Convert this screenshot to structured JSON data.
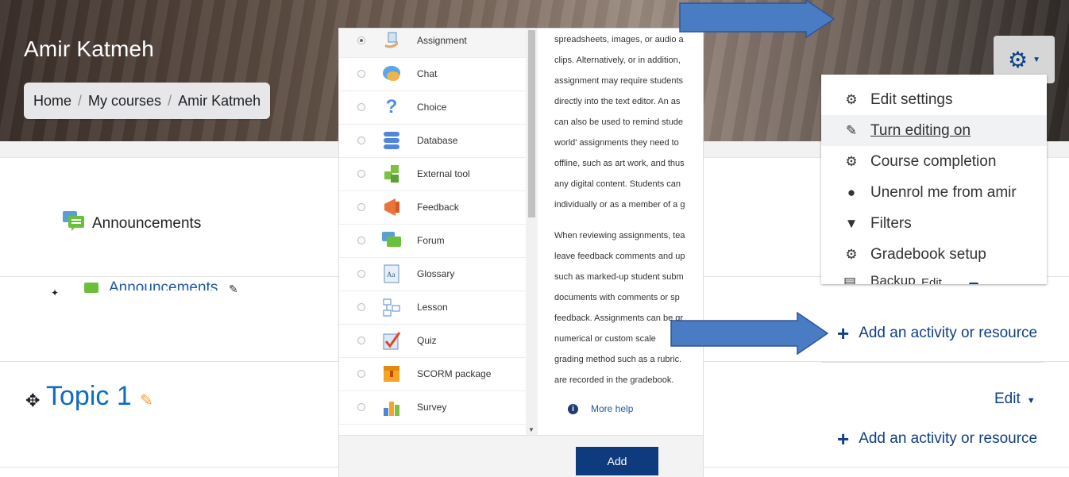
{
  "header": {
    "course_title": "Amir Katmeh",
    "breadcrumb": [
      "Home",
      "My courses",
      "Amir Katmeh"
    ],
    "breadcrumb_separator": "/"
  },
  "section0": {
    "title": "Announcements",
    "activity_link": "Announcements"
  },
  "topic1": {
    "title": "Topic 1",
    "edit_menu": "Edit"
  },
  "add_activity_label": "Add an activity or resource",
  "chooser": {
    "items": [
      {
        "label": "Assignment",
        "icon": "assignment-icon",
        "selected": true
      },
      {
        "label": "Chat",
        "icon": "chat-icon",
        "selected": false
      },
      {
        "label": "Choice",
        "icon": "choice-icon",
        "selected": false
      },
      {
        "label": "Database",
        "icon": "database-icon",
        "selected": false
      },
      {
        "label": "External tool",
        "icon": "external-tool-icon",
        "selected": false
      },
      {
        "label": "Feedback",
        "icon": "feedback-icon",
        "selected": false
      },
      {
        "label": "Forum",
        "icon": "forum-icon",
        "selected": false
      },
      {
        "label": "Glossary",
        "icon": "glossary-icon",
        "selected": false
      },
      {
        "label": "Lesson",
        "icon": "lesson-icon",
        "selected": false
      },
      {
        "label": "Quiz",
        "icon": "quiz-icon",
        "selected": false
      },
      {
        "label": "SCORM package",
        "icon": "scorm-icon",
        "selected": false
      },
      {
        "label": "Survey",
        "icon": "survey-icon",
        "selected": false
      }
    ],
    "description_lines": [
      "spreadsheets, images, or audio a",
      "clips. Alternatively, or in addition,",
      "assignment may require students",
      "directly into the text editor. An as",
      "can also be used to remind stude",
      "world' assignments they need to",
      "offline, such as art work, and thus",
      "any digital content. Students can",
      "individually or as a member of a g"
    ],
    "description_lines_2": [
      "When reviewing assignments, tea",
      "leave feedback comments and up",
      "such as marked-up student subm",
      "documents with comments or sp",
      "feedback. Assignments can be gr",
      "numerical or custom scale",
      "grading method such as a rubric.",
      "are recorded in the gradebook."
    ],
    "more_help": "More help",
    "add_button": "Add"
  },
  "settings_menu": {
    "items": [
      {
        "label": "Edit settings",
        "icon": "gear-icon"
      },
      {
        "label": "Turn editing on",
        "icon": "pencil-icon"
      },
      {
        "label": "Course completion",
        "icon": "gear-icon"
      },
      {
        "label": "Unenrol me from amir",
        "icon": "user-icon"
      },
      {
        "label": "Filters",
        "icon": "filter-icon"
      },
      {
        "label": "Gradebook setup",
        "icon": "gear-icon"
      }
    ],
    "cut_off_item": "Backup",
    "cut_off_overlay": "Edit"
  },
  "colors": {
    "link_blue": "#0f6cbf",
    "dark_blue": "#0f3f87",
    "arrow_fill": "#4a7cc4",
    "arrow_stroke": "#2f5597"
  }
}
